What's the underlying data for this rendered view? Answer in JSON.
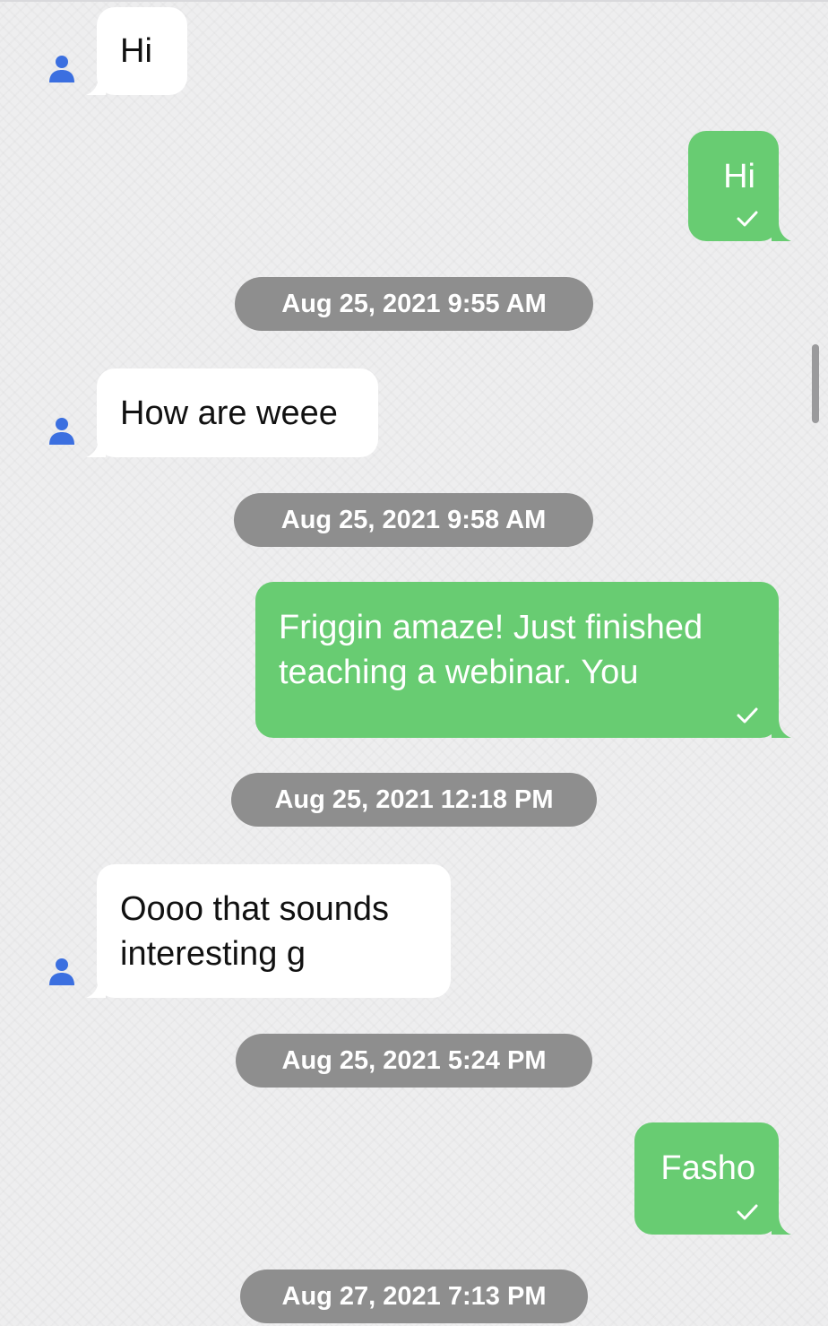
{
  "conversation": {
    "messages": [
      {
        "direction": "incoming",
        "text": "Hi"
      },
      {
        "direction": "outgoing",
        "text": "Hi",
        "status": "sent-check"
      },
      {
        "timestamp": "Aug 25, 2021 9:55 AM"
      },
      {
        "direction": "incoming",
        "text": "How are weee"
      },
      {
        "timestamp": "Aug 25, 2021 9:58 AM"
      },
      {
        "direction": "outgoing",
        "text": "Friggin amaze! Just finished\nteaching a webinar. You",
        "status": "sent-check"
      },
      {
        "timestamp": "Aug 25, 2021 12:18 PM"
      },
      {
        "direction": "incoming",
        "text": "Oooo that sounds\ninteresting g"
      },
      {
        "timestamp": "Aug 25, 2021 5:24 PM"
      },
      {
        "direction": "outgoing",
        "text": "Fasho",
        "status": "sent-check"
      },
      {
        "timestamp": "Aug 27, 2021 7:13 PM"
      }
    ]
  },
  "icons": {
    "avatar": "person-icon",
    "check": "checkmark-icon"
  },
  "colors": {
    "incoming_bubble": "#ffffff",
    "outgoing_bubble": "#68cc72",
    "timestamp_pill": "#8e8e8e",
    "avatar": "#3b6fe0",
    "background": "#eeeeef"
  }
}
